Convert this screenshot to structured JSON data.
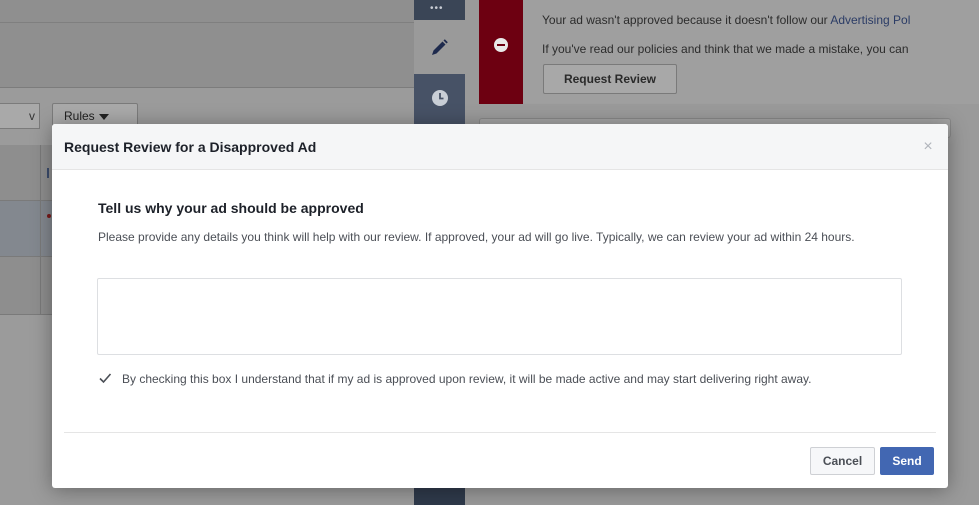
{
  "background": {
    "left_button_label": "v",
    "rules_button_label": "Rules",
    "error_message": "Your ad wasn't approved because it doesn't follow our ",
    "error_link": "Advertising Pol",
    "policy_message": "If you've read our policies and think that we made a mistake, you can",
    "request_review_button": "Request Review",
    "iconbar": {
      "top_icon": "more-dots-icon",
      "active_icon": "pencil-icon",
      "history_icon": "clock-icon"
    },
    "error_color": "#a1001a"
  },
  "modal": {
    "title": "Request Review for a Disapproved Ad",
    "close_glyph": "×",
    "heading": "Tell us why your ad should be approved",
    "description": "Please provide any details you think will help with our review. If approved, your ad will go live. Typically, we can review your ad within 24 hours.",
    "reason_input": {
      "value": "",
      "placeholder": ""
    },
    "consent": {
      "checked": true,
      "label": "By checking this box I understand that if my ad is approved upon review, it will be made active and may start delivering right away."
    },
    "cancel_label": "Cancel",
    "send_label": "Send",
    "primary_color": "#4267b2"
  }
}
